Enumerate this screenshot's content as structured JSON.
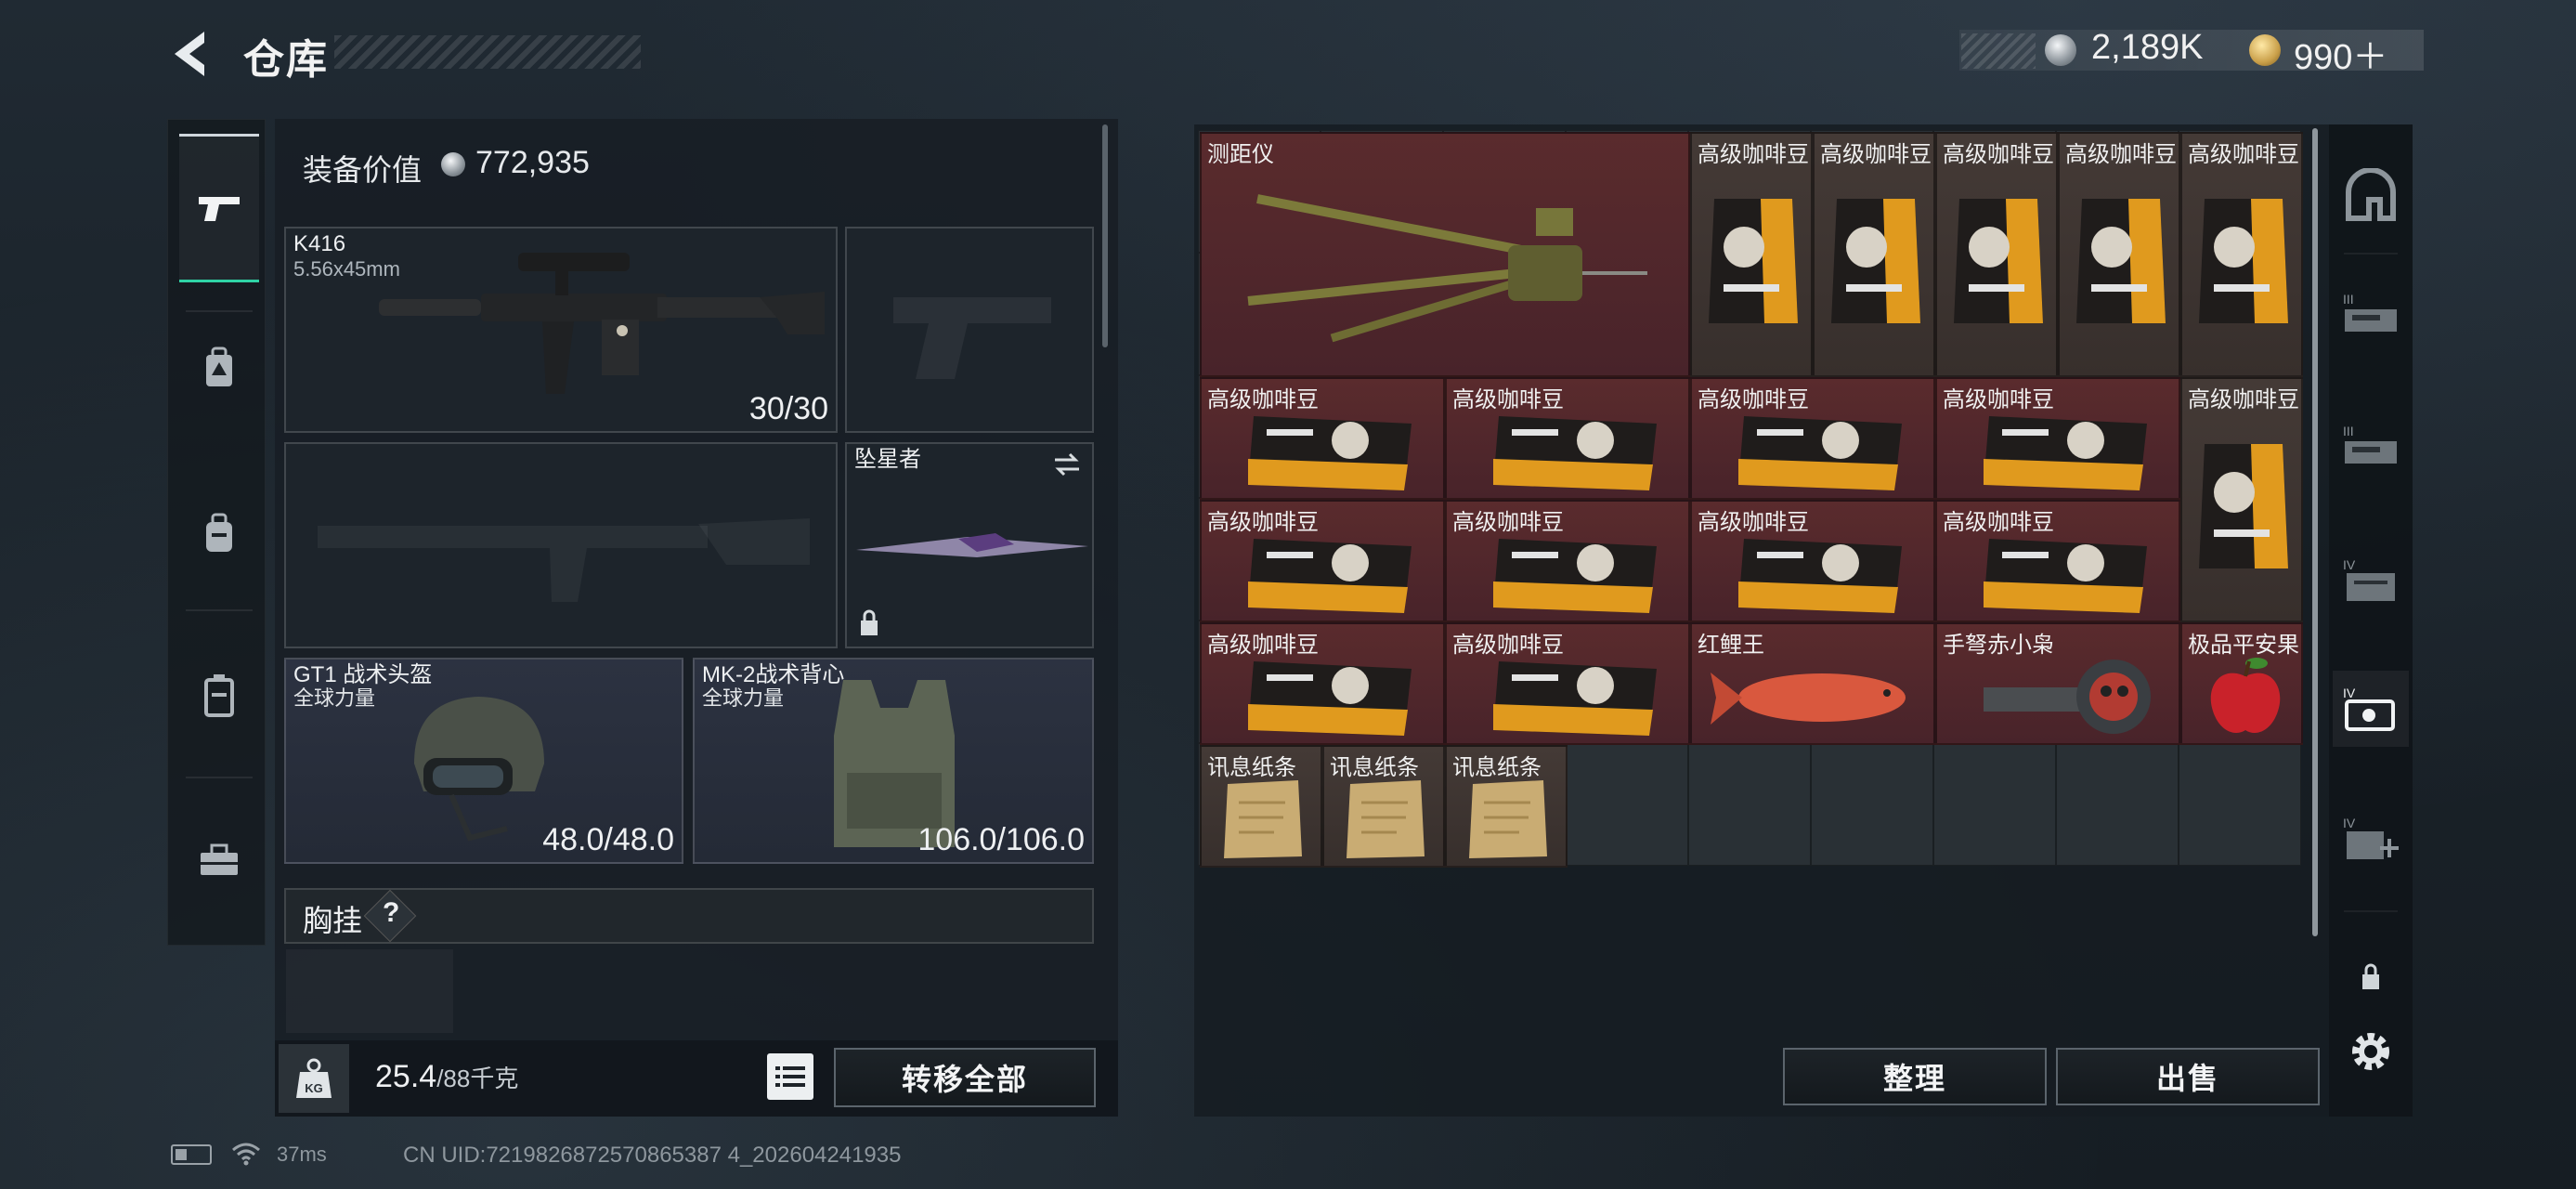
{
  "header": {
    "title": "仓库",
    "silver_amount": "2,189K",
    "gold_amount": "990＋",
    "back_icon": "back-arrow-icon"
  },
  "sidebar": {
    "tabs": [
      "pistol-icon",
      "backpack-alert-icon",
      "backpack-icon",
      "locker-icon",
      "toolbox-icon"
    ]
  },
  "equipment": {
    "value_label": "装备价值",
    "value": "772,935",
    "primary": {
      "name": "K416",
      "ammo_type": "5.56x45mm",
      "ammo": "30/30"
    },
    "melee": {
      "name": "坠星者"
    },
    "helmet": {
      "name": "GT1 战术头盔",
      "brand": "全球力量",
      "durability": "48.0/48.0"
    },
    "armor": {
      "name": "MK-2战术背心",
      "brand": "全球力量",
      "durability": "106.0/106.0"
    },
    "chest_rig": {
      "label": "胸挂",
      "help": "?"
    },
    "weight": "25.4",
    "weight_max": "/88千克",
    "transfer_all": "转移全部"
  },
  "storage": {
    "items": [
      {
        "name": "测距仪"
      },
      {
        "name": "高级咖啡豆"
      },
      {
        "name": "红鲤王"
      },
      {
        "name": "手弩赤小枭"
      },
      {
        "name": "极品平安果"
      },
      {
        "name": "讯息纸条"
      }
    ],
    "sort": "整理",
    "sell": "出售"
  },
  "status": {
    "ping": "37ms",
    "uid": "CN UID:7219826872570865387 4_202604241935"
  }
}
